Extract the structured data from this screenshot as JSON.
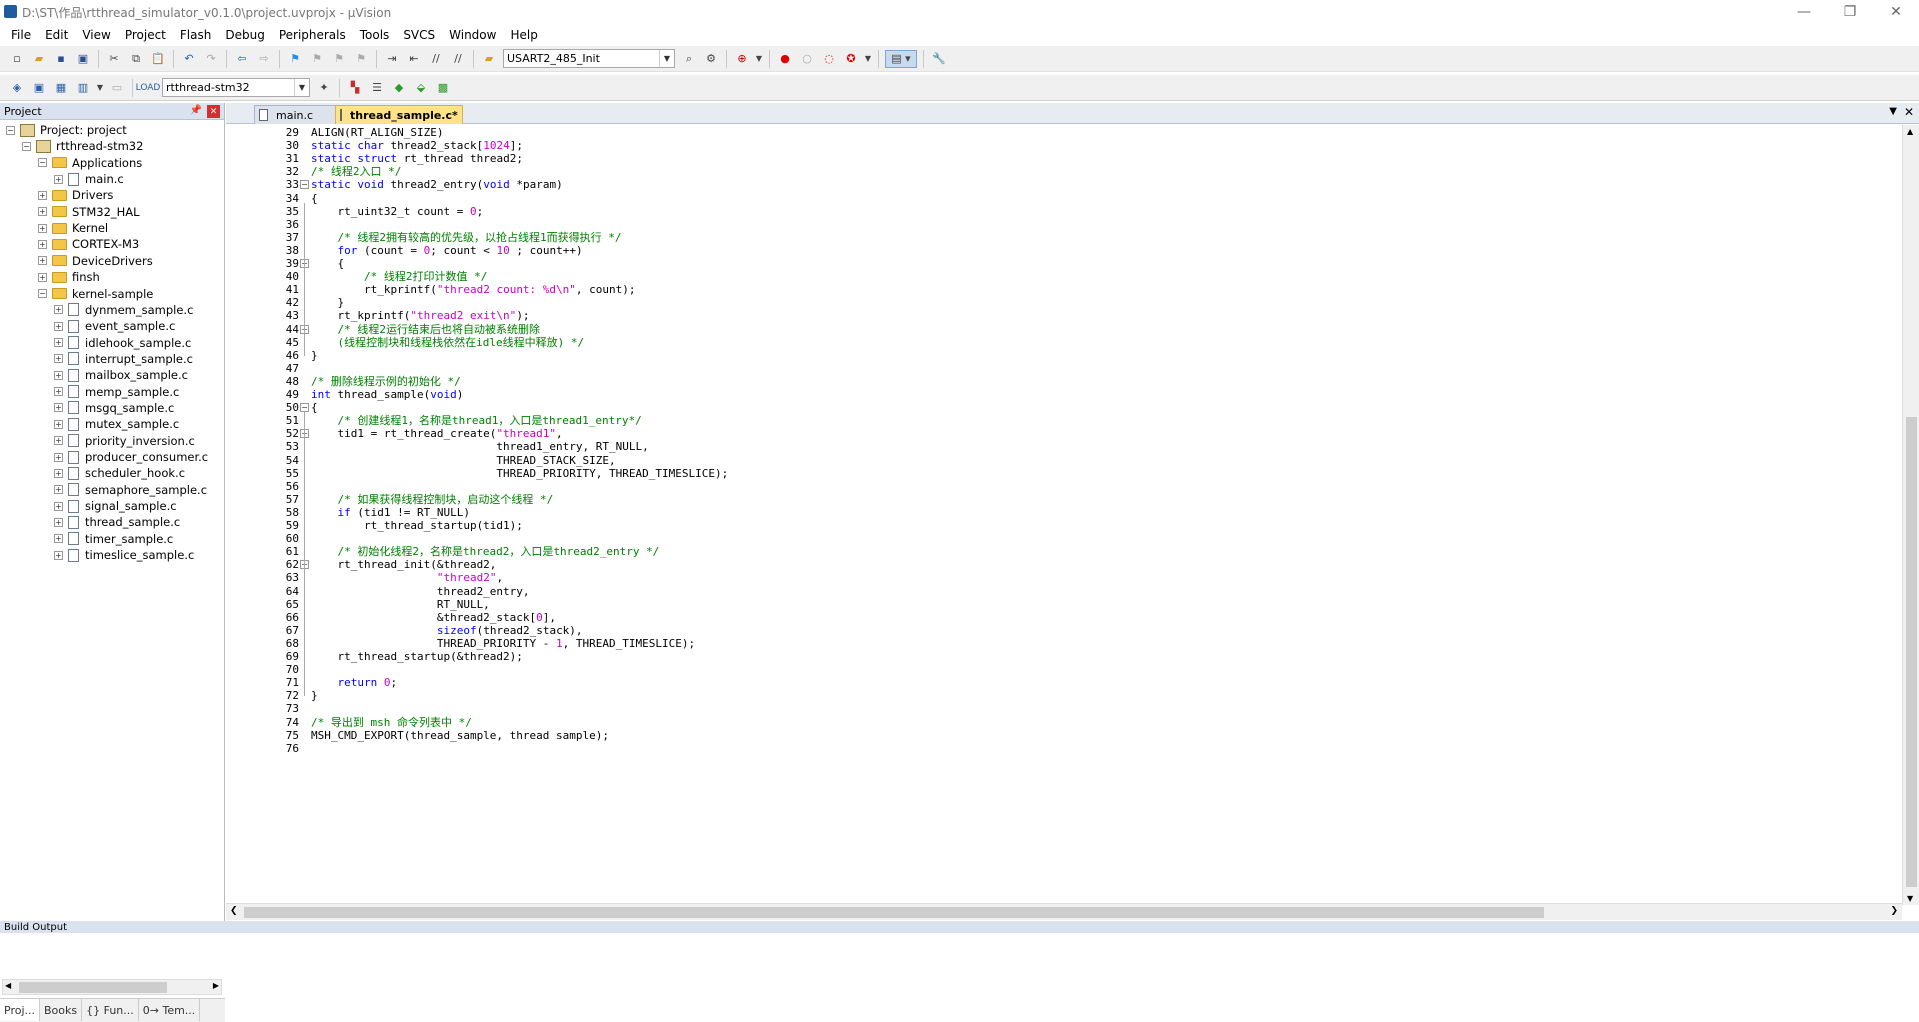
{
  "window": {
    "title": "D:\\ST\\作品\\rtthread_simulator_v0.1.0\\project.uvprojx - µVision"
  },
  "menu": [
    "File",
    "Edit",
    "View",
    "Project",
    "Flash",
    "Debug",
    "Peripherals",
    "Tools",
    "SVCS",
    "Window",
    "Help"
  ],
  "toolbar": {
    "function_combo": "USART2_485_Init",
    "target_combo": "rtthread-stm32"
  },
  "project_panel": {
    "title": "Project",
    "tree": [
      {
        "label": "Project: project",
        "level": 0,
        "kind": "project",
        "exp": "-"
      },
      {
        "label": "rtthread-stm32",
        "level": 1,
        "kind": "target",
        "exp": "-"
      },
      {
        "label": "Applications",
        "level": 2,
        "kind": "folder",
        "exp": "-"
      },
      {
        "label": "main.c",
        "level": 3,
        "kind": "file",
        "exp": "+"
      },
      {
        "label": "Drivers",
        "level": 2,
        "kind": "folder",
        "exp": "+"
      },
      {
        "label": "STM32_HAL",
        "level": 2,
        "kind": "folder",
        "exp": "+"
      },
      {
        "label": "Kernel",
        "level": 2,
        "kind": "folder",
        "exp": "+"
      },
      {
        "label": "CORTEX-M3",
        "level": 2,
        "kind": "folder",
        "exp": "+"
      },
      {
        "label": "DeviceDrivers",
        "level": 2,
        "kind": "folder",
        "exp": "+"
      },
      {
        "label": "finsh",
        "level": 2,
        "kind": "folder",
        "exp": "+"
      },
      {
        "label": "kernel-sample",
        "level": 2,
        "kind": "folder",
        "exp": "-"
      },
      {
        "label": "dynmem_sample.c",
        "level": 3,
        "kind": "file",
        "exp": "+"
      },
      {
        "label": "event_sample.c",
        "level": 3,
        "kind": "file",
        "exp": "+"
      },
      {
        "label": "idlehook_sample.c",
        "level": 3,
        "kind": "file",
        "exp": "+"
      },
      {
        "label": "interrupt_sample.c",
        "level": 3,
        "kind": "file",
        "exp": "+"
      },
      {
        "label": "mailbox_sample.c",
        "level": 3,
        "kind": "file",
        "exp": "+"
      },
      {
        "label": "memp_sample.c",
        "level": 3,
        "kind": "file",
        "exp": "+"
      },
      {
        "label": "msgq_sample.c",
        "level": 3,
        "kind": "file",
        "exp": "+"
      },
      {
        "label": "mutex_sample.c",
        "level": 3,
        "kind": "file",
        "exp": "+"
      },
      {
        "label": "priority_inversion.c",
        "level": 3,
        "kind": "file",
        "exp": "+"
      },
      {
        "label": "producer_consumer.c",
        "level": 3,
        "kind": "file",
        "exp": "+"
      },
      {
        "label": "scheduler_hook.c",
        "level": 3,
        "kind": "file",
        "exp": "+"
      },
      {
        "label": "semaphore_sample.c",
        "level": 3,
        "kind": "file",
        "exp": "+"
      },
      {
        "label": "signal_sample.c",
        "level": 3,
        "kind": "file",
        "exp": "+"
      },
      {
        "label": "thread_sample.c",
        "level": 3,
        "kind": "file",
        "exp": "+"
      },
      {
        "label": "timer_sample.c",
        "level": 3,
        "kind": "file",
        "exp": "+"
      },
      {
        "label": "timeslice_sample.c",
        "level": 3,
        "kind": "file",
        "exp": "+"
      }
    ],
    "bottom_tabs": [
      "Proj...",
      "Books",
      "{} Fun...",
      "0→ Tem..."
    ]
  },
  "editor": {
    "tabs": [
      {
        "label": "main.c",
        "active": false
      },
      {
        "label": "thread_sample.c*",
        "active": true
      }
    ],
    "lines": [
      {
        "n": "29",
        "segs": [
          [
            "p",
            "ALIGN(RT_ALIGN_SIZE)"
          ]
        ]
      },
      {
        "n": "30",
        "segs": [
          [
            "k",
            "static"
          ],
          [
            "p",
            " "
          ],
          [
            "k",
            "char"
          ],
          [
            "p",
            " thread2_stack["
          ],
          [
            "n",
            "1024"
          ],
          [
            "p",
            "];"
          ]
        ]
      },
      {
        "n": "31",
        "segs": [
          [
            "k",
            "static"
          ],
          [
            "p",
            " "
          ],
          [
            "k",
            "struct"
          ],
          [
            "p",
            " rt_thread thread2;"
          ]
        ]
      },
      {
        "n": "32",
        "segs": [
          [
            "c",
            "/* 线程2入口 */"
          ]
        ]
      },
      {
        "n": "33",
        "segs": [
          [
            "k",
            "static"
          ],
          [
            "p",
            " "
          ],
          [
            "k",
            "void"
          ],
          [
            "p",
            " thread2_entry("
          ],
          [
            "k",
            "void"
          ],
          [
            "p",
            " *param)"
          ]
        ],
        "fold": "-"
      },
      {
        "n": "34",
        "segs": [
          [
            "p",
            "{"
          ]
        ]
      },
      {
        "n": "35",
        "segs": [
          [
            "p",
            "    rt_uint32_t count = "
          ],
          [
            "n",
            "0"
          ],
          [
            "p",
            ";"
          ]
        ]
      },
      {
        "n": "36",
        "segs": []
      },
      {
        "n": "37",
        "segs": [
          [
            "p",
            "    "
          ],
          [
            "c",
            "/* 线程2拥有较高的优先级，以抢占线程1而获得执行 */"
          ]
        ]
      },
      {
        "n": "38",
        "segs": [
          [
            "p",
            "    "
          ],
          [
            "k",
            "for"
          ],
          [
            "p",
            " (count = "
          ],
          [
            "n",
            "0"
          ],
          [
            "p",
            "; count < "
          ],
          [
            "n",
            "10"
          ],
          [
            "p",
            " ; count++)"
          ]
        ]
      },
      {
        "n": "39",
        "segs": [
          [
            "p",
            "    {"
          ]
        ],
        "fold": "-"
      },
      {
        "n": "40",
        "segs": [
          [
            "p",
            "        "
          ],
          [
            "c",
            "/* 线程2打印计数值 */"
          ]
        ]
      },
      {
        "n": "41",
        "segs": [
          [
            "p",
            "        rt_kprintf("
          ],
          [
            "s",
            "\"thread2 count: %d\\n\""
          ],
          [
            "p",
            ", count);"
          ]
        ]
      },
      {
        "n": "42",
        "segs": [
          [
            "p",
            "    }"
          ]
        ]
      },
      {
        "n": "43",
        "segs": [
          [
            "p",
            "    rt_kprintf("
          ],
          [
            "s",
            "\"thread2 exit\\n\""
          ],
          [
            "p",
            ");"
          ]
        ]
      },
      {
        "n": "44",
        "segs": [
          [
            "p",
            "    "
          ],
          [
            "c",
            "/* 线程2运行结束后也将自动被系统删除"
          ]
        ],
        "fold": "-"
      },
      {
        "n": "45",
        "segs": [
          [
            "c",
            "    (线程控制块和线程栈依然在idle线程中释放) */"
          ]
        ]
      },
      {
        "n": "46",
        "segs": [
          [
            "p",
            "}"
          ]
        ]
      },
      {
        "n": "47",
        "segs": []
      },
      {
        "n": "48",
        "segs": [
          [
            "c",
            "/* 删除线程示例的初始化 */"
          ]
        ]
      },
      {
        "n": "49",
        "segs": [
          [
            "k",
            "int"
          ],
          [
            "p",
            " thread_sample("
          ],
          [
            "k",
            "void"
          ],
          [
            "p",
            ")"
          ]
        ]
      },
      {
        "n": "50",
        "segs": [
          [
            "p",
            "{"
          ]
        ],
        "fold": "-"
      },
      {
        "n": "51",
        "segs": [
          [
            "p",
            "    "
          ],
          [
            "c",
            "/* 创建线程1，名称是thread1，入口是thread1_entry*/"
          ]
        ]
      },
      {
        "n": "52",
        "segs": [
          [
            "p",
            "    tid1 = rt_thread_create("
          ],
          [
            "s",
            "\"thread1\""
          ],
          [
            "p",
            ","
          ]
        ],
        "fold": "-"
      },
      {
        "n": "53",
        "segs": [
          [
            "p",
            "                            thread1_entry, RT_NULL,"
          ]
        ]
      },
      {
        "n": "54",
        "segs": [
          [
            "p",
            "                            THREAD_STACK_SIZE,"
          ]
        ]
      },
      {
        "n": "55",
        "segs": [
          [
            "p",
            "                            THREAD_PRIORITY, THREAD_TIMESLICE);"
          ]
        ]
      },
      {
        "n": "56",
        "segs": []
      },
      {
        "n": "57",
        "segs": [
          [
            "p",
            "    "
          ],
          [
            "c",
            "/* 如果获得线程控制块，启动这个线程 */"
          ]
        ]
      },
      {
        "n": "58",
        "segs": [
          [
            "p",
            "    "
          ],
          [
            "k",
            "if"
          ],
          [
            "p",
            " (tid1 != RT_NULL)"
          ]
        ]
      },
      {
        "n": "59",
        "segs": [
          [
            "p",
            "        rt_thread_startup(tid1);"
          ]
        ]
      },
      {
        "n": "60",
        "segs": []
      },
      {
        "n": "61",
        "segs": [
          [
            "p",
            "    "
          ],
          [
            "c",
            "/* 初始化线程2，名称是thread2，入口是thread2_entry */"
          ]
        ]
      },
      {
        "n": "62",
        "segs": [
          [
            "p",
            "    rt_thread_init(&thread2,"
          ]
        ],
        "fold": "-"
      },
      {
        "n": "63",
        "segs": [
          [
            "p",
            "                   "
          ],
          [
            "s",
            "\"thread2\""
          ],
          [
            "p",
            ","
          ]
        ]
      },
      {
        "n": "64",
        "segs": [
          [
            "p",
            "                   thread2_entry,"
          ]
        ]
      },
      {
        "n": "65",
        "segs": [
          [
            "p",
            "                   RT_NULL,"
          ]
        ]
      },
      {
        "n": "66",
        "segs": [
          [
            "p",
            "                   &thread2_stack["
          ],
          [
            "n",
            "0"
          ],
          [
            "p",
            "],"
          ]
        ]
      },
      {
        "n": "67",
        "segs": [
          [
            "p",
            "                   "
          ],
          [
            "k",
            "sizeof"
          ],
          [
            "p",
            "(thread2_stack),"
          ]
        ]
      },
      {
        "n": "68",
        "segs": [
          [
            "p",
            "                   THREAD_PRIORITY - "
          ],
          [
            "n",
            "1"
          ],
          [
            "p",
            ", THREAD_TIMESLICE);"
          ]
        ]
      },
      {
        "n": "69",
        "segs": [
          [
            "p",
            "    rt_thread_startup(&thread2);"
          ]
        ]
      },
      {
        "n": "70",
        "segs": []
      },
      {
        "n": "71",
        "segs": [
          [
            "p",
            "    "
          ],
          [
            "k",
            "return"
          ],
          [
            "p",
            " "
          ],
          [
            "n",
            "0"
          ],
          [
            "p",
            ";"
          ]
        ]
      },
      {
        "n": "72",
        "segs": [
          [
            "p",
            "}"
          ]
        ]
      },
      {
        "n": "73",
        "segs": []
      },
      {
        "n": "74",
        "segs": [
          [
            "c",
            "/* 导出到 msh 命令列表中 */"
          ]
        ]
      },
      {
        "n": "75",
        "segs": [
          [
            "p",
            "MSH_CMD_EXPORT(thread_sample, thread sample);"
          ]
        ]
      },
      {
        "n": "76",
        "segs": []
      }
    ]
  },
  "status": {
    "build_output": "Build Output"
  }
}
